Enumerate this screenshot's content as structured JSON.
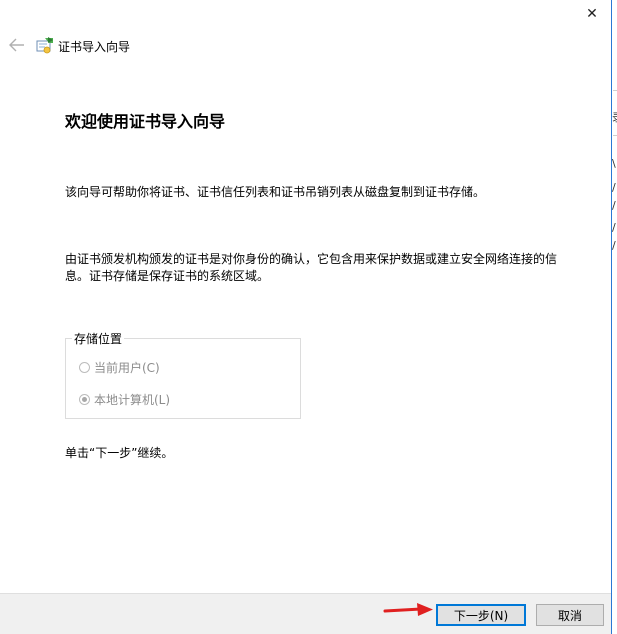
{
  "window": {
    "title": "证书导入向导",
    "close_glyph": "✕",
    "back_glyph": "←"
  },
  "main": {
    "heading": "欢迎使用证书导入向导",
    "para1": "该向导可帮助你将证书、证书信任列表和证书吊销列表从磁盘复制到证书存储。",
    "para2_line1": "由证书颁发机构颁发的证书是对你身份的确认，它包含用来保护数据或建立安全网络连接的信",
    "para2_line2": "息。证书存储是保存证书的系统区域。",
    "store_location": {
      "legend": "存储位置",
      "options": [
        {
          "label": "当前用户(C)",
          "checked": false
        },
        {
          "label": "本地计算机(L)",
          "checked": true
        }
      ]
    },
    "continue_text": "单击“下一步”继续。"
  },
  "footer": {
    "next_label": "下一步(N)",
    "cancel_label": "取消"
  },
  "background_window": {
    "glyphs": [
      "录",
      "\\",
      "/",
      "/",
      "/",
      "/"
    ]
  },
  "colors": {
    "accent": "#0078d7",
    "window_border": "#2b78d4",
    "annotation_arrow": "#e02020",
    "disabled_text": "#8c8c8c",
    "footer_bg": "#f0f0f0"
  }
}
